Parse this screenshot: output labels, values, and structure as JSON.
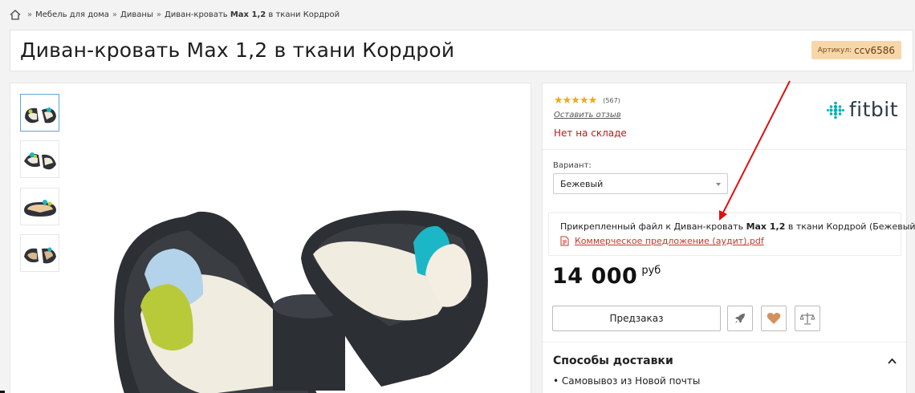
{
  "breadcrumb": {
    "items": [
      "Мебель для дома",
      "Диваны"
    ],
    "separator": "»",
    "current_prefix": "Диван-кровать",
    "current_bold": "Max 1,2",
    "current_suffix": "в ткани Кордрой"
  },
  "product": {
    "title": "Диван-кровать Max 1,2 в ткани Кордрой",
    "sku_label": "Артикул:",
    "sku_code": "ccv6586"
  },
  "rating": {
    "stars": "★★★★★",
    "count": "(567)",
    "review_link": "Оставить отзыв",
    "stock": "Нет на складе"
  },
  "brand": {
    "name": "fitbit"
  },
  "variant": {
    "label": "Вариант:",
    "selected": "Бежевый"
  },
  "attachment": {
    "text_prefix": "Прикрепленный файл к Диван-кровать",
    "text_bold": "Max 1,2",
    "text_suffix": "в ткани Кордрой (Бежевый)",
    "file_name": "Коммерческое предложение (аудит).pdf"
  },
  "price": {
    "amount": "14 000",
    "currency": "руб"
  },
  "actions": {
    "preorder_label": "Предзаказ"
  },
  "delivery": {
    "title": "Способы доставки",
    "items": [
      "Самовывоз из Новой почты"
    ]
  },
  "colors": {
    "accent": "#c0171c",
    "sku_badge": "#f7d7a9",
    "star": "#f0a91b",
    "brand_dots": "#00b0b9",
    "heart": "#d4915f",
    "annotation_arrow": "#e01010"
  },
  "icons": [
    "home-icon",
    "pdf-file-icon",
    "rocket-icon",
    "heart-icon",
    "scales-icon",
    "chevron-up-icon",
    "fitbit-logo"
  ]
}
